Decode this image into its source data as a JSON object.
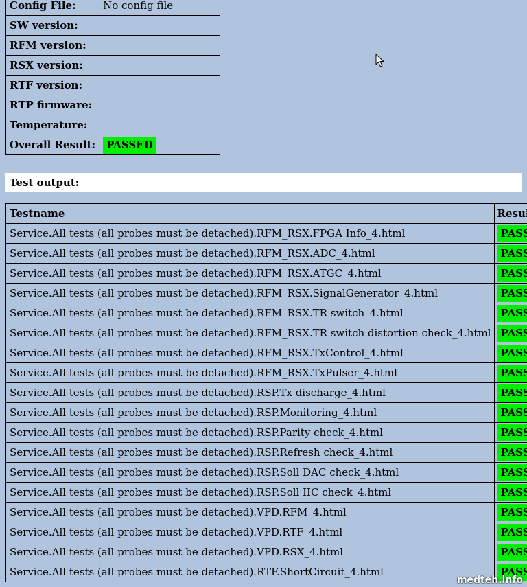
{
  "info": [
    {
      "label": "Config File:",
      "value": "No config file"
    },
    {
      "label": "SW version:",
      "value": ""
    },
    {
      "label": "RFM version:",
      "value": ""
    },
    {
      "label": "RSX version:",
      "value": ""
    },
    {
      "label": "RTF version:",
      "value": ""
    },
    {
      "label": "RTP firmware:",
      "value": ""
    },
    {
      "label": "Temperature:",
      "value": ""
    },
    {
      "label": "Overall Result:",
      "value": "PASSED"
    }
  ],
  "test_output_label": "Test output:",
  "results": {
    "headers": {
      "name": "Testname",
      "result": "Result"
    },
    "rows": [
      {
        "name": "Service.All tests (all probes must be detached).RFM_RSX.FPGA Info_4.html",
        "result": "PASSED"
      },
      {
        "name": "Service.All tests (all probes must be detached).RFM_RSX.ADC_4.html",
        "result": "PASSED"
      },
      {
        "name": "Service.All tests (all probes must be detached).RFM_RSX.ATGC_4.html",
        "result": "PASSED"
      },
      {
        "name": "Service.All tests (all probes must be detached).RFM_RSX.SignalGenerator_4.html",
        "result": "PASSED"
      },
      {
        "name": "Service.All tests (all probes must be detached).RFM_RSX.TR switch_4.html",
        "result": "PASSED"
      },
      {
        "name": "Service.All tests (all probes must be detached).RFM_RSX.TR switch distortion check_4.html",
        "result": "PASSED"
      },
      {
        "name": "Service.All tests (all probes must be detached).RFM_RSX.TxControl_4.html",
        "result": "PASSED"
      },
      {
        "name": "Service.All tests (all probes must be detached).RFM_RSX.TxPulser_4.html",
        "result": "PASSED"
      },
      {
        "name": "Service.All tests (all probes must be detached).RSP.Tx discharge_4.html",
        "result": "PASSED"
      },
      {
        "name": "Service.All tests (all probes must be detached).RSP.Monitoring_4.html",
        "result": "PASSED"
      },
      {
        "name": "Service.All tests (all probes must be detached).RSP.Parity check_4.html",
        "result": "PASSED"
      },
      {
        "name": "Service.All tests (all probes must be detached).RSP.Refresh check_4.html",
        "result": "PASSED"
      },
      {
        "name": "Service.All tests (all probes must be detached).RSP.Soll DAC check_4.html",
        "result": "PASSED"
      },
      {
        "name": "Service.All tests (all probes must be detached).RSP.Soll IIC check_4.html",
        "result": "PASSED"
      },
      {
        "name": "Service.All tests (all probes must be detached).VPD.RFM_4.html",
        "result": "PASSED"
      },
      {
        "name": "Service.All tests (all probes must be detached).VPD.RTF_4.html",
        "result": "PASSED"
      },
      {
        "name": "Service.All tests (all probes must be detached).VPD.RSX_4.html",
        "result": "PASSED"
      },
      {
        "name": "Service.All tests (all probes must be detached).RTF.ShortCircuit_4.html",
        "result": "PASSED"
      }
    ]
  },
  "watermark": "medteh.info",
  "colors": {
    "background": "#b0c4de",
    "passed": "#00ee00"
  },
  "icons": {
    "cursor": "mouse-pointer-icon"
  }
}
